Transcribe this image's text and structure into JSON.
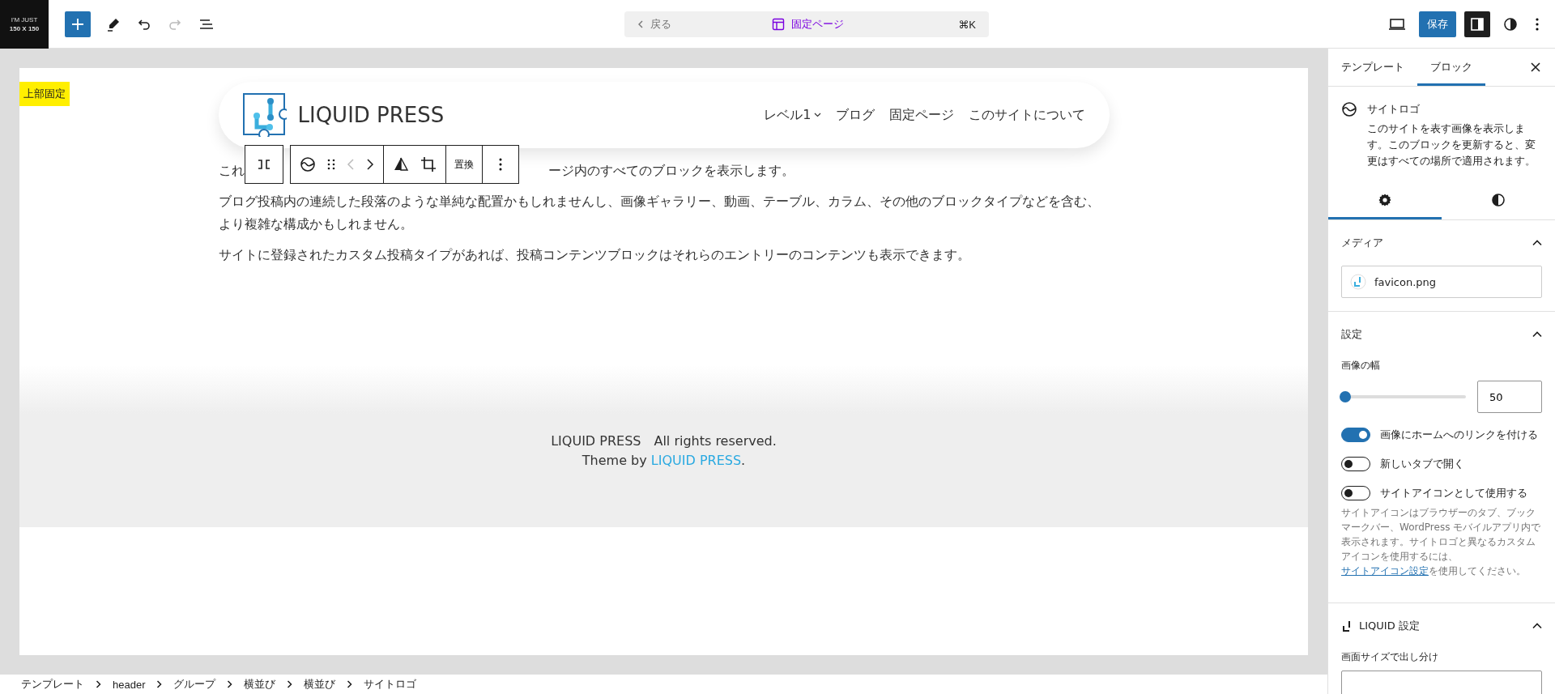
{
  "site_icon": {
    "line1": "I'M JUST",
    "line2": "150 X 150"
  },
  "command_bar": {
    "back": "戻る",
    "title": "固定ページ",
    "shortcut": "⌘K"
  },
  "save_button": "保存",
  "frame_label": "上部固定",
  "header": {
    "site_title": "LIQUID PRESS",
    "nav": [
      {
        "label": "レベル1",
        "has_submenu": true
      },
      {
        "label": "ブログ",
        "has_submenu": false
      },
      {
        "label": "固定ページ",
        "has_submenu": false
      },
      {
        "label": "このサイトについて",
        "has_submenu": false
      }
    ]
  },
  "block_toolbar": {
    "replace": "置換"
  },
  "paragraph_1": {
    "start": "これ",
    "end": "ージ内のすべてのブロックを表示します。"
  },
  "paragraphs": [
    "ブログ投稿内の連続した段落のような単純な配置かもしれませんし、画像ギャラリー、動画、テーブル、カラム、その他のブロックタイプなどを含む、より複雑な構成かもしれません。",
    "サイトに登録されたカスタム投稿タイプがあれば、投稿コンテンツブロックはそれらのエントリーのコンテンツも表示できます。"
  ],
  "footer": {
    "copyright": "LIQUID PRESS　All rights reserved.",
    "theme_by": "Theme by ",
    "theme_link": "LIQUID PRESS",
    "end": "."
  },
  "breadcrumbs": [
    "テンプレート",
    "header",
    "グループ",
    "横並び",
    "横並び",
    "サイトロゴ"
  ],
  "sidebar": {
    "tabs": [
      {
        "label": "テンプレート",
        "selected": false
      },
      {
        "label": "ブロック",
        "selected": true
      }
    ],
    "block": {
      "title": "サイトロゴ",
      "description": "このサイトを表す画像を表示します。このブロックを更新すると、変更はすべての場所で適用されます。"
    },
    "panel_tabs": [
      {
        "selected": true
      },
      {
        "selected": false
      }
    ],
    "media": {
      "title": "メディア",
      "expanded": true,
      "file": "favicon.png"
    },
    "settings": {
      "title": "設定",
      "expanded": true,
      "width_label": "画像の幅",
      "width_value": "50",
      "level": 0,
      "toggles": [
        {
          "label": "画像にホームへのリンクを付ける",
          "on": true
        },
        {
          "label": "新しいタブで開く",
          "on": false
        },
        {
          "label": "サイトアイコンとして使用する",
          "on": false
        }
      ],
      "help": "サイトアイコンはブラウザーのタブ、ブックマークバー、WordPress モバイルアプリ内で表示されます。サイトロゴと異なるカスタムアイコンを使用するには、",
      "help_link": "サイトアイコン設定",
      "help_end": "を使用してください。"
    },
    "liquid": {
      "title": "LIQUID 設定",
      "expanded": true,
      "field_label": "画面サイズで出し分け"
    }
  }
}
